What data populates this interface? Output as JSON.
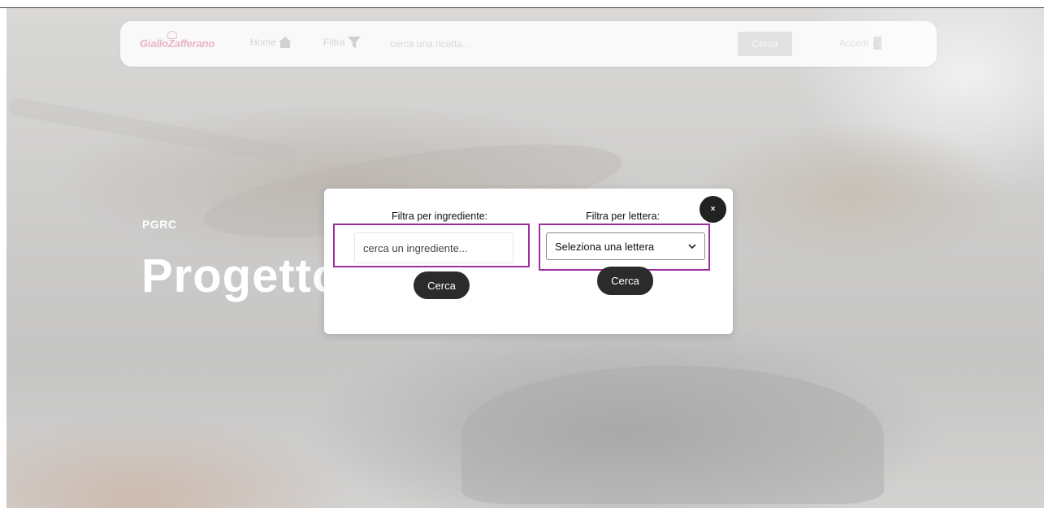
{
  "navbar": {
    "logo": "GialloZafferano",
    "home_label": "Home",
    "filtra_label": "Filtra",
    "search_placeholder": "cerca una ricetta...",
    "search_button": "Cerca",
    "accedi_label": "Accedi",
    "icons": {
      "home": "house-icon",
      "filtra": "filter-funnel-icon",
      "accedi": "door-icon"
    }
  },
  "hero": {
    "brand": "PGRC",
    "title": "Progetto web"
  },
  "modal": {
    "close_label": "×",
    "ingredient": {
      "label": "Filtra per ingrediente:",
      "placeholder": "cerca un ingrediente...",
      "button": "Cerca"
    },
    "letter": {
      "label": "Filtra per lettera:",
      "selected": "Seleziona una lettera",
      "button": "Cerca"
    }
  },
  "colors": {
    "highlight_frame": "#9b2fa0",
    "button_dark": "#2b2b2b",
    "logo_pink": "#e9b5c8"
  }
}
